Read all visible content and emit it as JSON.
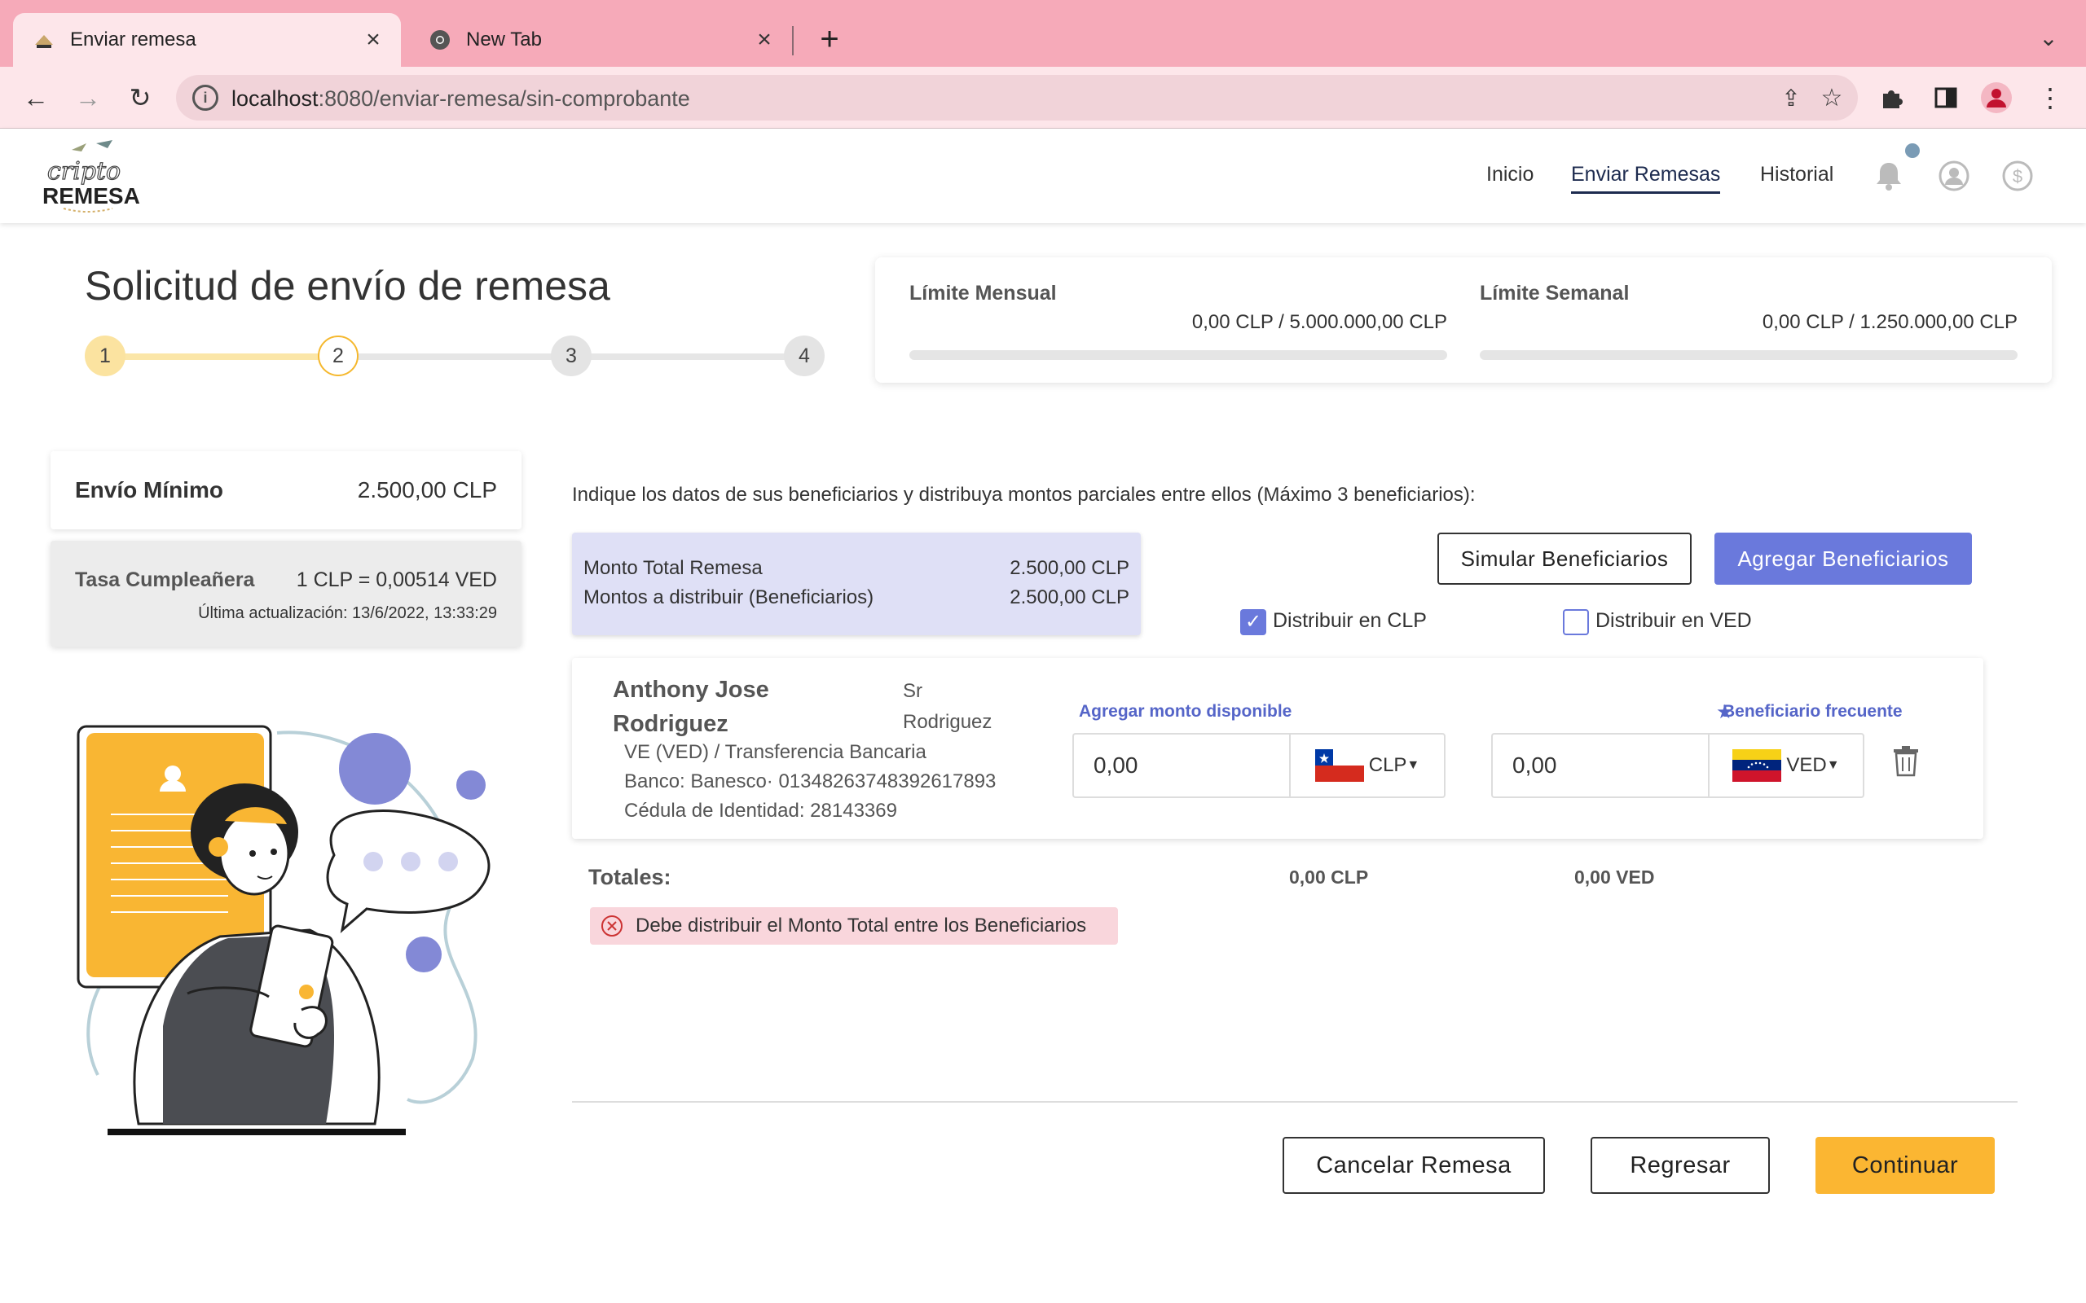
{
  "browser": {
    "tabs": [
      {
        "label": "Enviar remesa",
        "active": true
      },
      {
        "label": "New Tab",
        "active": false
      }
    ],
    "url_host": "localhost",
    "url_path": ":8080/enviar-remesa/sin-comprobante"
  },
  "header": {
    "logo_top": "cripto",
    "logo_bottom": "REMESA",
    "nav": [
      "Inicio",
      "Enviar Remesas",
      "Historial"
    ]
  },
  "page": {
    "title": "Solicitud de envío de remesa",
    "steps": [
      "1",
      "2",
      "3",
      "4"
    ],
    "current_step": 2
  },
  "limits": {
    "monthly_title": "Límite Mensual",
    "monthly_value": "0,00 CLP / 5.000.000,00 CLP",
    "monthly_used_fraction": 0,
    "weekly_title": "Límite Semanal",
    "weekly_value": "0,00 CLP / 1.250.000,00 CLP",
    "weekly_used_fraction": 0
  },
  "sidebar": {
    "min_label": "Envío Mínimo",
    "min_value": "2.500,00 CLP",
    "rate_label": "Tasa Cumpleañera",
    "rate_value": "1 CLP = 0,00514 VED",
    "rate_updated": "Última actualización: 13/6/2022, 13:33:29"
  },
  "main": {
    "instructions": "Indique los datos de sus beneficiarios y distribuya montos parciales entre ellos (Máximo 3 beneficiarios):",
    "total_label": "Monto Total Remesa",
    "total_value": "2.500,00 CLP",
    "distribute_label": "Montos a distribuir (Beneficiarios)",
    "distribute_value": "2.500,00 CLP",
    "btn_simular": "Simular Beneficiarios",
    "btn_agregar": "Agregar Beneficiarios",
    "chk_clp_label": "Distribuir en CLP",
    "chk_clp_checked": true,
    "chk_ved_label": "Distribuir en VED",
    "chk_ved_checked": false
  },
  "beneficiary": {
    "name": "Anthony Jose Rodriguez",
    "title": "Sr Rodriguez",
    "method": "VE (VED) / Transferencia Bancaria",
    "bank": "Banco: Banesco· 01348263748392617893",
    "id": "Cédula de Identidad: 28143369",
    "add_monto_label": "Agregar monto disponible",
    "favorite_label": "Beneficiario frecuente",
    "amount_clp": "0,00",
    "currency_clp": "CLP",
    "amount_ved": "0,00",
    "currency_ved": "VED"
  },
  "totals": {
    "label": "Totales:",
    "clp": "0,00 CLP",
    "ved": "0,00 VED",
    "error": "Debe distribuir el Monto Total entre los Beneficiarios"
  },
  "footer_buttons": {
    "cancelar": "Cancelar Remesa",
    "regresar": "Regresar",
    "continuar": "Continuar"
  },
  "colors": {
    "accent": "#6a79dc",
    "primary_button": "#fbb632",
    "error_bg": "#f9d6dc"
  }
}
